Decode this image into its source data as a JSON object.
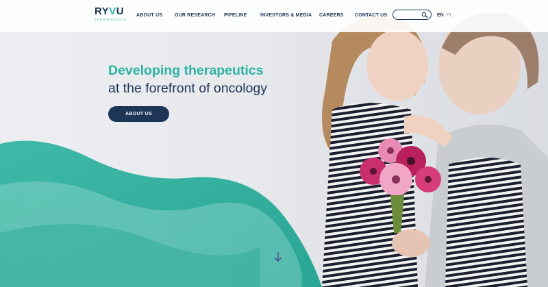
{
  "brand": {
    "logo_text_main": "RYVU",
    "logo_text_sub": "THERAPEUTICS",
    "colors": {
      "navy": "#1d3557",
      "teal": "#2bb3a3"
    }
  },
  "nav": {
    "items": [
      {
        "label": "ABOUT US"
      },
      {
        "label": "OUR RESEARCH"
      },
      {
        "label": "PIPELINE"
      },
      {
        "label": "INVESTORS & MEDIA"
      },
      {
        "label": "CAREERS"
      },
      {
        "label": "CONTACT US"
      }
    ]
  },
  "search": {
    "value": "",
    "icon": "search-icon"
  },
  "languages": {
    "active": "EN",
    "other": "PL"
  },
  "hero": {
    "headline_accent": "Developing therapeutics",
    "headline_main": "at the forefront of oncology",
    "cta_label": "ABOUT US"
  },
  "scroll": {
    "icon": "arrow-down-icon"
  }
}
